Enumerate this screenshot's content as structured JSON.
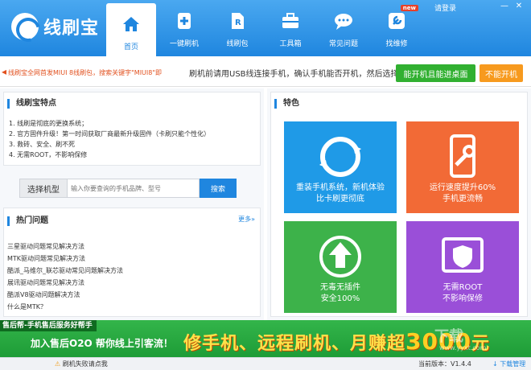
{
  "app": {
    "name": "线刷宝"
  },
  "nav": [
    {
      "label": "首页",
      "icon": "home-icon"
    },
    {
      "label": "一键刷机",
      "icon": "plus-icon"
    },
    {
      "label": "线刷包",
      "icon": "package-icon"
    },
    {
      "label": "工具箱",
      "icon": "toolbox-icon"
    },
    {
      "label": "常见问题",
      "icon": "chat-icon"
    },
    {
      "label": "找维修",
      "icon": "repair-icon"
    }
  ],
  "new_badge": "new",
  "login": "请登录",
  "window_controls": {
    "minimize": "—",
    "close": "✕"
  },
  "notice": {
    "text": "线刷宝全网首发MIUI 8线刷包，搜索关键字\"MIUI8\"即",
    "hint": "刷机前请用USB线连接手机，确认手机能否开机，然后选择",
    "btn_can_boot": "能开机且能进桌面",
    "btn_cannot_boot": "不能开机"
  },
  "features": {
    "title": "线刷宝特点",
    "items": [
      "1. 线刷是彻底的更换系统；",
      "2. 官方固件升级！第一时间获取厂商最新升级固件（卡刷只能个性化）",
      "3. 救砖、安全、刷不死",
      "4. 无需ROOT，不影响保修"
    ]
  },
  "search": {
    "select_label": "选择机型",
    "placeholder": "输入你要查询的手机品牌、型号",
    "button": "搜索"
  },
  "hot": {
    "title": "热门问题",
    "more": "更多»",
    "items": [
      "三星驱动问题常见解决方法",
      "MTK驱动问题常见解决方法",
      "酷派_马维尔_联芯驱动常见问题解决方法",
      "展讯驱动问题常见解决方法",
      "酷派V8驱动问题解决方法",
      "什么是MTK？"
    ]
  },
  "right": {
    "title": "特色",
    "tiles": [
      {
        "line1": "重装手机系统，新机体验",
        "line2": "比卡刷更彻底"
      },
      {
        "line1": "运行速度提升60%",
        "line2": "手机更流畅"
      },
      {
        "line1": "无毒无插件",
        "line2": "安全100%"
      },
      {
        "line1": "无需ROOT",
        "line2": "不影响保修"
      }
    ]
  },
  "banner": {
    "tag": "售后帮-手机售后服务好帮手",
    "sub": "加入售后O2O 帮你线上引客流！",
    "main": "修手机、远程刷机、月赚超",
    "money": "3000",
    "unit": "元"
  },
  "watermark": {
    "text": "下载",
    "url": "www.yyxt.com"
  },
  "status": {
    "fail": "刷机失败请点我",
    "version": "当前版本：V1.4.4",
    "download": "下载管理"
  },
  "colors": {
    "primary": "#1f86df",
    "green": "#31b031",
    "orange": "#f79a1e",
    "notice": "#e2511f"
  }
}
